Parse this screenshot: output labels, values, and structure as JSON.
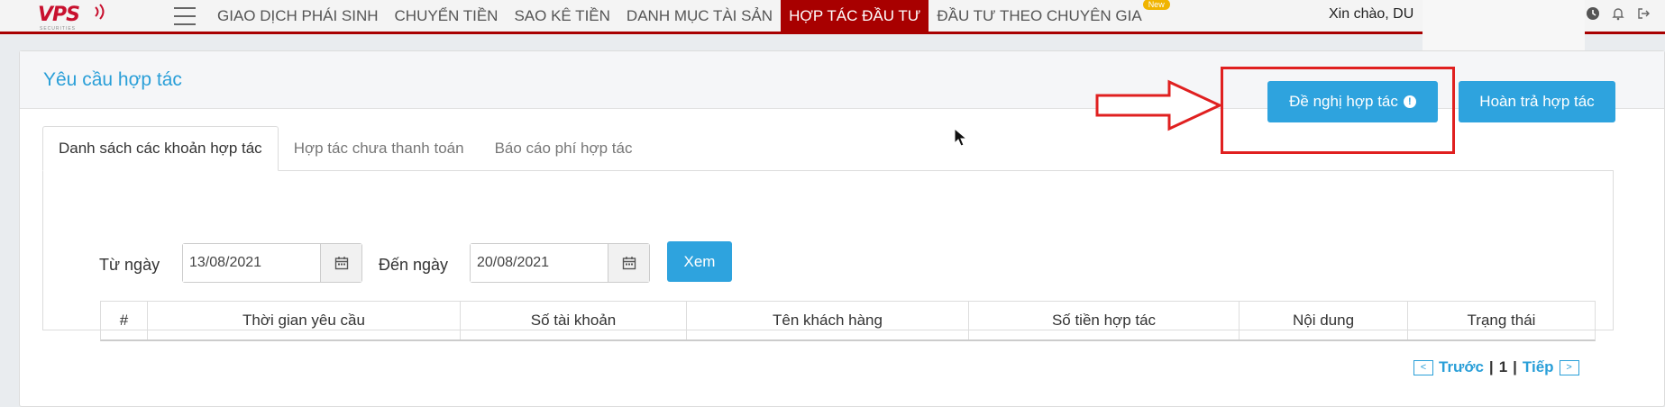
{
  "brand": {
    "logo_text": "VPS",
    "logo_sub": "SECURITIES"
  },
  "nav": {
    "items": [
      {
        "label": "GIAO DỊCH PHÁI SINH"
      },
      {
        "label": "CHUYỂN TIỀN"
      },
      {
        "label": "SAO KÊ TIỀN"
      },
      {
        "label": "DANH MỤC TÀI SẢN"
      },
      {
        "label": "HỢP TÁC ĐẦU TƯ"
      },
      {
        "label": "ĐẦU TƯ THEO CHUYÊN GIA"
      }
    ],
    "new_badge": "New",
    "greeting": "Xin chào, DU",
    "active_color": "#a80000"
  },
  "page": {
    "title": "Yêu cầu hợp tác"
  },
  "actions": {
    "propose_label": "Đề nghị hợp tác",
    "return_label": "Hoàn trả hợp tác",
    "info_glyph": "!"
  },
  "tabs": [
    {
      "label": "Danh sách các khoản hợp tác"
    },
    {
      "label": "Hợp tác chưa thanh toán"
    },
    {
      "label": "Báo cáo phí hợp tác"
    }
  ],
  "filters": {
    "from_label": "Từ ngày",
    "from_value": "13/08/2021",
    "to_label": "Đến ngày",
    "to_value": "20/08/2021",
    "view_label": "Xem"
  },
  "table": {
    "columns": [
      "#",
      "Thời gian yêu cầu",
      "Số tài khoản",
      "Tên khách hàng",
      "Số tiền hợp tác",
      "Nội dung",
      "Trạng thái"
    ]
  },
  "pagination": {
    "prev_glyph": "<",
    "prev_label": "Trước",
    "current": "1",
    "sep": "|",
    "next_label": "Tiếp",
    "next_glyph": ">"
  },
  "colors": {
    "accent": "#2ea3de",
    "highlight": "#e02020"
  }
}
